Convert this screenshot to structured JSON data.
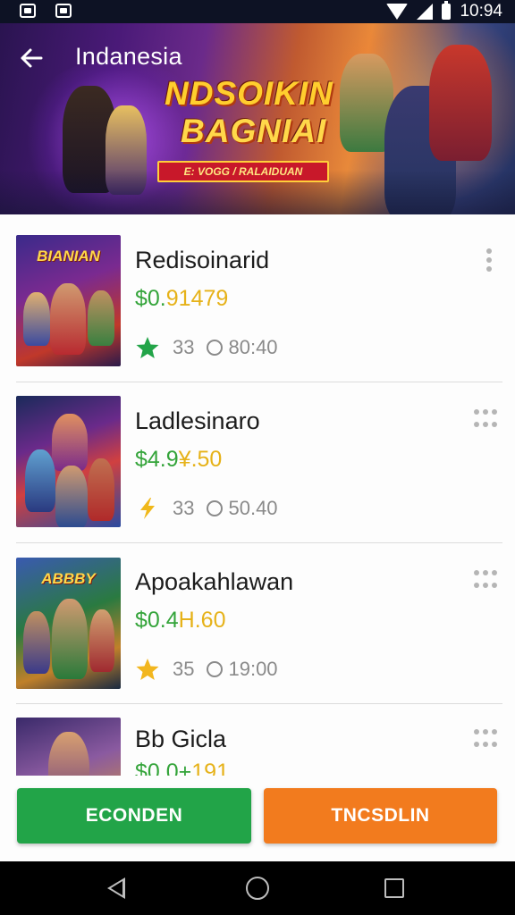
{
  "status_bar": {
    "time": "10:94"
  },
  "header": {
    "title": "Indanesia",
    "logo_line1": "NDSOIKIN",
    "logo_line2": "BAGNIAI",
    "ribbon_text": "E: VOGG / RALAIDUAN"
  },
  "games": [
    {
      "name": "Redisoinarid",
      "price_a": "$0.",
      "price_b": "91479",
      "rating_count": "33",
      "players": "80:40",
      "badge": "green-star-icon",
      "thumb_title": "BIANIAN"
    },
    {
      "name": "Ladlesinaro",
      "price_a": "$4.9",
      "price_b": "¥.50",
      "rating_count": "33",
      "players": "50.40",
      "badge": "lightning-icon",
      "thumb_title": ""
    },
    {
      "name": "Apoakahlawan",
      "price_a": "$0.4",
      "price_b": "H.60",
      "rating_count": "35",
      "players": "19:00",
      "badge": "gold-star-icon",
      "thumb_title": "ABBBY"
    },
    {
      "name": "Bb Gicla",
      "price_a": "$0 0+",
      "price_b": "191",
      "rating_count": "",
      "players": "",
      "badge": "",
      "thumb_title": ""
    }
  ],
  "actions": {
    "primary_label": "ECONDEN",
    "secondary_label": "TNCSDLIN"
  },
  "colors": {
    "green": "#22a448",
    "orange": "#f27b1e",
    "price_green": "#34a43a",
    "price_gold": "#e6b219"
  }
}
